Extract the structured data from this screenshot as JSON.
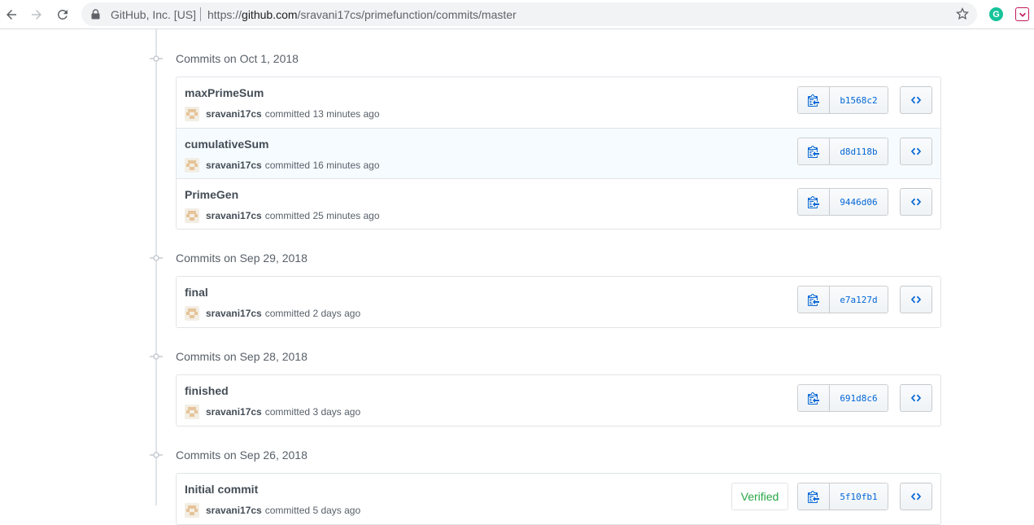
{
  "browser": {
    "site_identity": "GitHub, Inc. [US]",
    "url_scheme": "https://",
    "url_host": "github.com",
    "url_path": "/sravani17cs/primefunction/commits/master"
  },
  "colors": {
    "link": "#0366d6",
    "verified": "#28a745",
    "row_highlight": "#f6fbff",
    "timeline": "#e1e4e8"
  },
  "groups": [
    {
      "title": "Commits on Oct 1, 2018",
      "commits": [
        {
          "message": "maxPrimeSum",
          "author": "sravani17cs",
          "action": "committed",
          "time": "13 minutes ago",
          "sha": "b1568c2"
        },
        {
          "message": "cumulativeSum",
          "author": "sravani17cs",
          "action": "committed",
          "time": "16 minutes ago",
          "sha": "d8d118b"
        },
        {
          "message": "PrimeGen",
          "author": "sravani17cs",
          "action": "committed",
          "time": "25 minutes ago",
          "sha": "9446d06"
        }
      ]
    },
    {
      "title": "Commits on Sep 29, 2018",
      "commits": [
        {
          "message": "final",
          "author": "sravani17cs",
          "action": "committed",
          "time": "2 days ago",
          "sha": "e7a127d"
        }
      ]
    },
    {
      "title": "Commits on Sep 28, 2018",
      "commits": [
        {
          "message": "finished",
          "author": "sravani17cs",
          "action": "committed",
          "time": "3 days ago",
          "sha": "691d8c6"
        }
      ]
    },
    {
      "title": "Commits on Sep 26, 2018",
      "commits": [
        {
          "message": "Initial commit",
          "author": "sravani17cs",
          "action": "committed",
          "time": "5 days ago",
          "sha": "5f10fb1",
          "badge": "Verified"
        }
      ]
    }
  ]
}
